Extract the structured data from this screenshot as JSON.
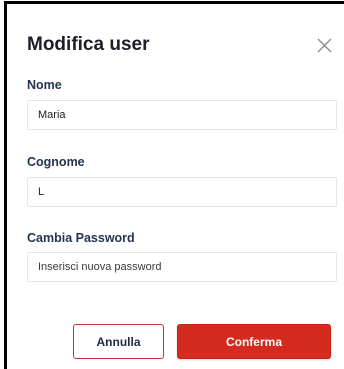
{
  "modal": {
    "title": "Modifica user",
    "close_icon": "close-icon"
  },
  "fields": {
    "nome": {
      "label": "Nome",
      "value": "Maria",
      "placeholder": ""
    },
    "cognome": {
      "label": "Cognome",
      "value": "L",
      "placeholder": ""
    },
    "password": {
      "label": "Cambia Password",
      "value": "",
      "placeholder": "Inserisci nuova password"
    }
  },
  "actions": {
    "cancel_label": "Annulla",
    "confirm_label": "Conferma"
  },
  "colors": {
    "accent": "#d42a1f",
    "label": "#23344f",
    "title": "#1e1e2a"
  }
}
